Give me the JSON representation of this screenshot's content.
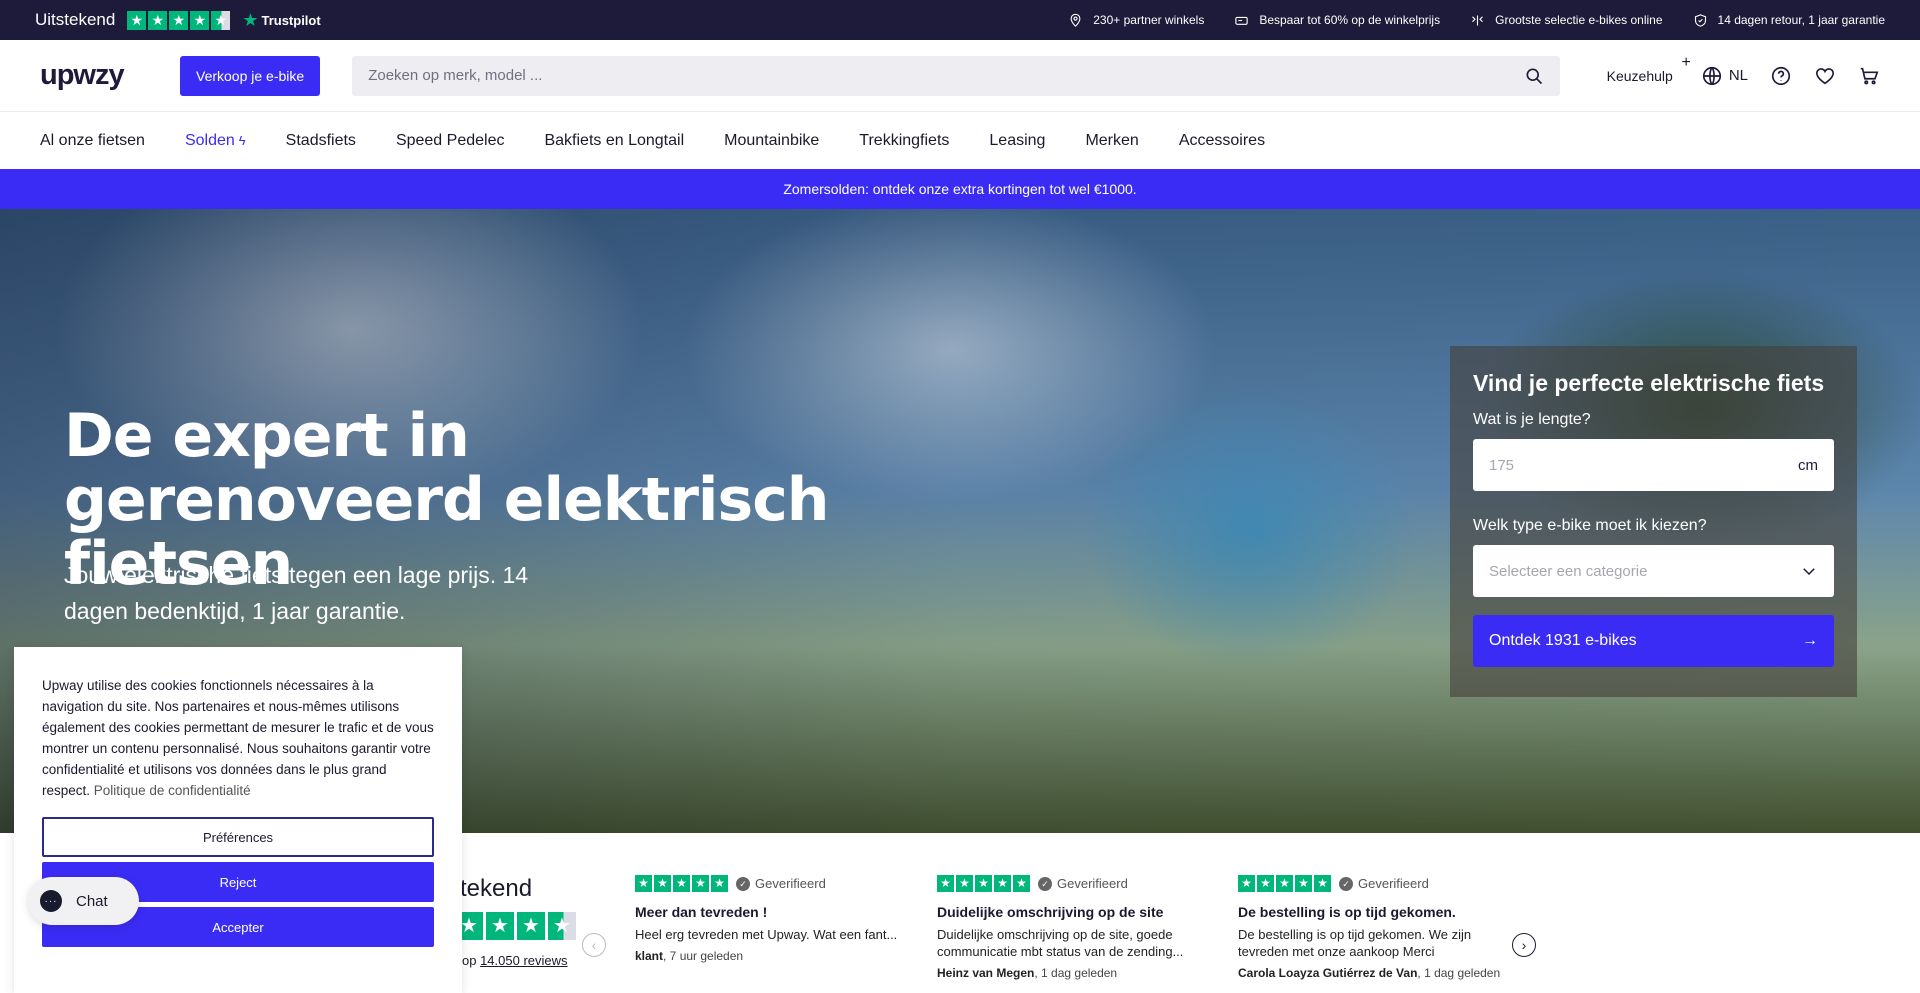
{
  "topbar": {
    "rating": "Uitstekend",
    "trustpilot": "Trustpilot",
    "usps": [
      {
        "icon": "location-pin-icon",
        "text": "230+ partner winkels"
      },
      {
        "icon": "tag-icon",
        "text": "Bespaar tot 60% op de winkelprijs"
      },
      {
        "icon": "route-icon",
        "text": "Grootste selectie e-bikes online"
      },
      {
        "icon": "shield-icon",
        "text": "14 dagen retour, 1 jaar garantie"
      }
    ]
  },
  "header": {
    "logo": "upwzy",
    "sell_label": "Verkoop je e-bike",
    "search_placeholder": "Zoeken op merk, model ...",
    "keuzehulp": "Keuzehulp",
    "lang": "NL"
  },
  "nav": [
    "Al onze fietsen",
    "Solden",
    "Stadsfiets",
    "Speed Pedelec",
    "Bakfiets en Longtail",
    "Mountainbike",
    "Trekkingfiets",
    "Leasing",
    "Merken",
    "Accessoires"
  ],
  "promo": "Zomersolden: ontdek onze extra kortingen tot wel €1000.",
  "hero": {
    "title": "De expert in gerenoveerd elektrisch fietsen",
    "subtitle": "Jouw elektrische fiets tegen een lage prijs. 14 dagen bedenktijd, 1 jaar garantie."
  },
  "finder": {
    "title": "Vind je perfecte elektrische fiets",
    "height_label": "Wat is je lengte?",
    "height_placeholder": "175",
    "height_unit": "cm",
    "type_label": "Welk type e-bike moet ik kiezen?",
    "type_placeholder": "Selecteer een categorie",
    "cta": "Ontdek 1931 e-bikes"
  },
  "reviews": {
    "heading": "tekend",
    "count_prefix": "op ",
    "count_link": "14.050 reviews",
    "verified": "Geverifieerd",
    "cards": [
      {
        "title": "Meer dan tevreden !",
        "text": "Heel erg tevreden met Upway. Wat een fant...",
        "author": "klant",
        "time": ", 7 uur geleden"
      },
      {
        "title": "Duidelijke omschrijving op de site",
        "text": "Duidelijke omschrijving op de site, goede communicatie mbt status van de zending...",
        "author": "Heinz van Megen",
        "time": ", 1 dag geleden"
      },
      {
        "title": "De bestelling is op tijd gekomen.",
        "text": "De bestelling is op tijd gekomen. We zijn tevreden met onze aankoop Merci",
        "author": "Carola Loayza Gutiérrez de Van",
        "time": ", 1 dag geleden"
      }
    ]
  },
  "cookie": {
    "text": "Upway utilise des cookies fonctionnels nécessaires à la navigation du site. Nos partenaires et nous-mêmes utilisons également des cookies permettant de mesurer le trafic et de vous montrer un contenu personnalisé. Nous souhaitons garantir votre confidentialité et utilisons vos données dans le plus grand respect.",
    "policy_link": "Politique de confidentialité",
    "preferences": "Préférences",
    "reject": "Reject",
    "accept": "Accepter"
  },
  "chat": {
    "label": "Chat"
  },
  "colors": {
    "brand": "#3b2cf5",
    "topbar": "#1d1a3a",
    "trustpilot": "#00b67a"
  }
}
